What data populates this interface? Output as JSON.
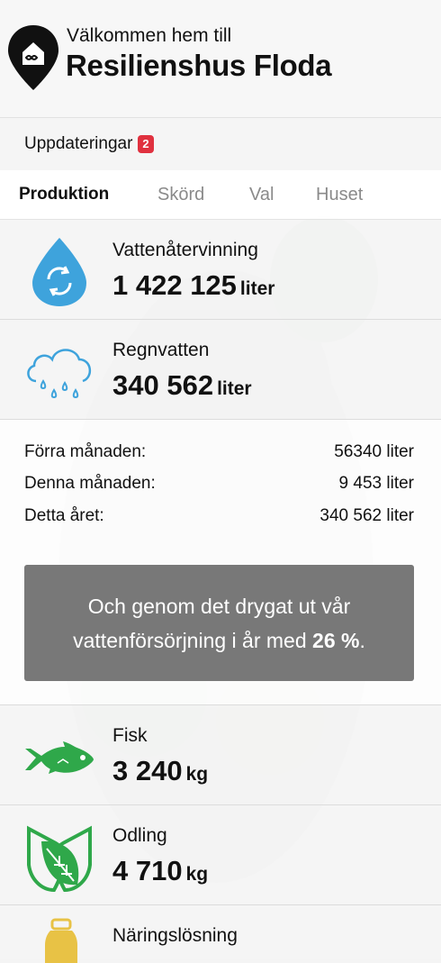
{
  "header": {
    "welcome": "Välkommen hem till",
    "title": "Resilienshus Floda",
    "logo_icon": "home-pin-icon"
  },
  "updates": {
    "label": "Uppdateringar",
    "count": "2"
  },
  "tabs": [
    {
      "label": "Produktion",
      "active": true
    },
    {
      "label": "Skörd",
      "active": false
    },
    {
      "label": "Val",
      "active": false
    },
    {
      "label": "Huset",
      "active": false
    }
  ],
  "cards": {
    "water_recycling": {
      "label": "Vattenåtervinning",
      "value": "1 422 125",
      "unit": "liter",
      "icon": "water-recycle-icon"
    },
    "rainwater": {
      "label": "Regnvatten",
      "value": "340 562",
      "unit": "liter",
      "icon": "rain-cloud-icon"
    },
    "fish": {
      "label": "Fisk",
      "value": "3 240",
      "unit": "kg",
      "icon": "fish-icon"
    },
    "cultivation": {
      "label": "Odling",
      "value": "4 710",
      "unit": "kg",
      "icon": "leaf-icon"
    },
    "nutrient": {
      "label": "Näringslösning",
      "icon": "bottle-icon"
    }
  },
  "rain_details": {
    "last_month_label": "Förra månaden:",
    "last_month_value": "56340 liter",
    "this_month_label": "Denna månaden:",
    "this_month_value": "9 453 liter",
    "this_year_label": "Detta året:",
    "this_year_value": "340 562 liter",
    "notice_text": "Och genom det drygat ut vår vattenförsörjning i år med",
    "notice_percent": "26 %",
    "notice_end": "."
  },
  "colors": {
    "accent_blue": "#3ea3dc",
    "accent_green": "#2fa84a",
    "badge_red": "#e0313f",
    "accent_yellow": "#e8c245"
  }
}
